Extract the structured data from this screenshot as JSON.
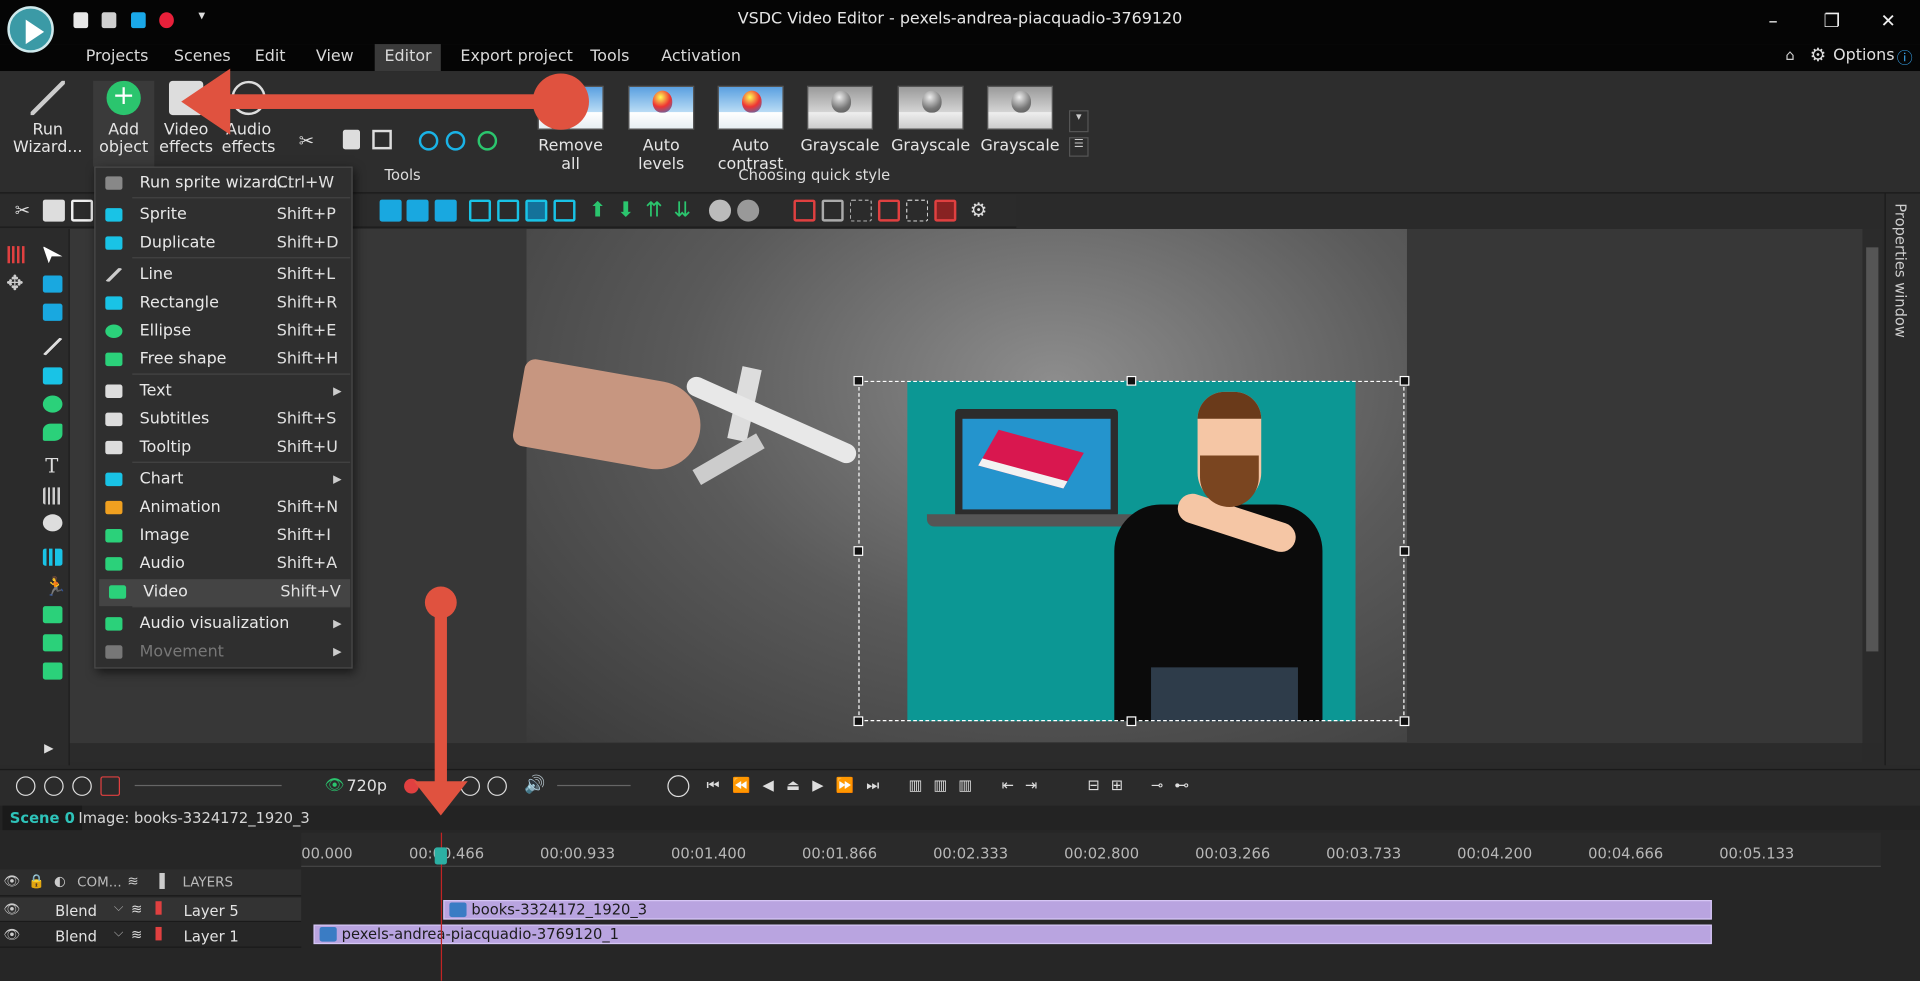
{
  "window": {
    "title": "VSDC Video Editor - pexels-andrea-piacquadio-3769120"
  },
  "menu": [
    "Projects",
    "Scenes",
    "Edit",
    "View",
    "Editor",
    "Export project",
    "Tools",
    "Activation"
  ],
  "options_label": "Options",
  "ribbon": {
    "run_wizard": [
      "Run",
      "Wizard..."
    ],
    "add_object": [
      "Add",
      "object"
    ],
    "video_effects": [
      "Video",
      "effects"
    ],
    "audio_effects": [
      "Audio",
      "effects"
    ],
    "tools_group": "Tools",
    "quick_style_group": "Choosing quick style",
    "quick_styles": [
      "Remove all",
      "Auto levels",
      "Auto contrast",
      "Grayscale",
      "Grayscale",
      "Grayscale"
    ]
  },
  "dropdown": [
    {
      "label": "Run sprite wizard...",
      "shortcut": "Ctrl+W",
      "icon": "wand-icon",
      "color": "#888888"
    },
    {
      "label": "Sprite",
      "shortcut": "Shift+P",
      "icon": "sprite-icon",
      "color": "#19c3e6"
    },
    {
      "label": "Duplicate",
      "shortcut": "Shift+D",
      "icon": "duplicate-icon",
      "color": "#19c3e6"
    },
    {
      "label": "Line",
      "shortcut": "Shift+L",
      "icon": "line-icon",
      "color": "#cccccc"
    },
    {
      "label": "Rectangle",
      "shortcut": "Shift+R",
      "icon": "rectangle-icon",
      "color": "#19c3e6"
    },
    {
      "label": "Ellipse",
      "shortcut": "Shift+E",
      "icon": "ellipse-icon",
      "color": "#2bd17a"
    },
    {
      "label": "Free shape",
      "shortcut": "Shift+H",
      "icon": "free-shape-icon",
      "color": "#2bd17a"
    },
    {
      "label": "Text",
      "shortcut": "",
      "icon": "text-icon",
      "color": "#dddddd",
      "submenu": true
    },
    {
      "label": "Subtitles",
      "shortcut": "Shift+S",
      "icon": "subtitles-icon",
      "color": "#dddddd"
    },
    {
      "label": "Tooltip",
      "shortcut": "Shift+U",
      "icon": "tooltip-icon",
      "color": "#dddddd"
    },
    {
      "label": "Chart",
      "shortcut": "",
      "icon": "chart-icon",
      "color": "#19c3e6",
      "submenu": true
    },
    {
      "label": "Animation",
      "shortcut": "Shift+N",
      "icon": "animation-icon",
      "color": "#f0a020"
    },
    {
      "label": "Image",
      "shortcut": "Shift+I",
      "icon": "image-icon",
      "color": "#2bd17a"
    },
    {
      "label": "Audio",
      "shortcut": "Shift+A",
      "icon": "audio-icon",
      "color": "#2bd17a"
    },
    {
      "label": "Video",
      "shortcut": "Shift+V",
      "icon": "video-icon",
      "color": "#2bd17a",
      "highlighted": true
    },
    {
      "label": "Audio visualization",
      "shortcut": "",
      "icon": "audio-visualization-icon",
      "color": "#2bd17a",
      "submenu": true
    },
    {
      "label": "Movement",
      "shortcut": "",
      "icon": "movement-icon",
      "color": "#777777",
      "submenu": true,
      "disabled": true
    }
  ],
  "playback": {
    "quality": "720p"
  },
  "tabs": [
    "Scene 0",
    "Image: books-3324172_1920_3"
  ],
  "timeline": {
    "header": {
      "com": "COM...",
      "layers": "LAYERS"
    },
    "ticks": [
      "00.000",
      "00:00.466",
      "00:00.933",
      "00:01.400",
      "00:01.866",
      "00:02.333",
      "00:02.800",
      "00:03.266",
      "00:03.733",
      "00:04.200",
      "00:04.666",
      "00:05.133"
    ],
    "rows": [
      {
        "blend": "Blend",
        "layer": "Layer 5",
        "clip": "books-3324172_1920_3"
      },
      {
        "blend": "Blend",
        "layer": "Layer 1",
        "clip": "pexels-andrea-piacquadio-3769120_1"
      }
    ]
  },
  "properties_window": "Properties window",
  "colors": {
    "accent": "#2ec3b9",
    "arrow": "#e0523f",
    "clip": "#b9a4e0",
    "image_bg": "#0c9794"
  }
}
